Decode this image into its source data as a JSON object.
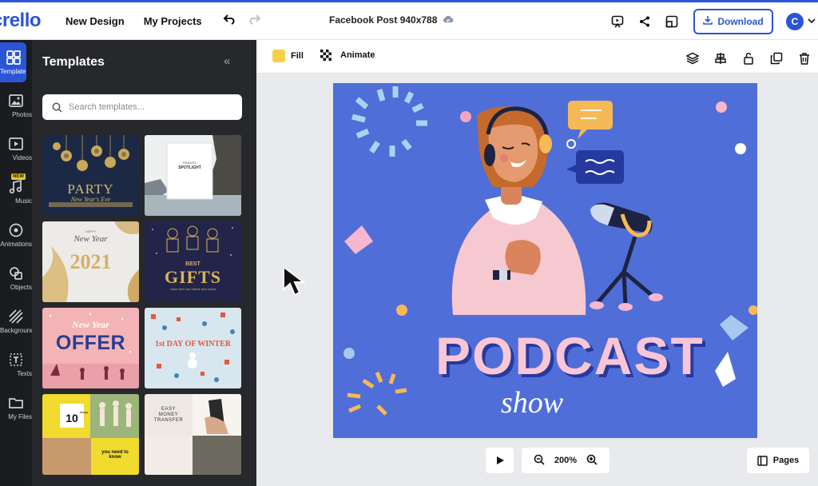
{
  "app": {
    "logo": "crello",
    "document_name": "Facebook Post 940x788"
  },
  "topnav": {
    "new_design": "New Design",
    "my_projects": "My Projects"
  },
  "header_actions": {
    "download_label": "Download",
    "avatar_letter": "C"
  },
  "sidebar": {
    "items": [
      {
        "label": "Templates",
        "icon": "templates-icon",
        "active": true
      },
      {
        "label": "Photos",
        "icon": "photo-icon"
      },
      {
        "label": "Videos",
        "icon": "video-icon"
      },
      {
        "label": "Music",
        "icon": "music-icon",
        "badge": "NEW"
      },
      {
        "label": "Animations",
        "icon": "animation-icon"
      },
      {
        "label": "Objects",
        "icon": "objects-icon"
      },
      {
        "label": "Backgrounds",
        "icon": "backgrounds-icon"
      },
      {
        "label": "Texts",
        "icon": "text-icon"
      },
      {
        "label": "My Files",
        "icon": "folder-icon"
      }
    ]
  },
  "panel": {
    "title": "Templates",
    "search_placeholder": "Search templates...",
    "templates": [
      {
        "line1": "PARTY",
        "line2": "New Year's Eve"
      },
      {
        "line1": "TRAVEL",
        "line2": "SPOTLIGHT"
      },
      {
        "line1": "HAPPY",
        "line2": "New Year",
        "line3": "2021"
      },
      {
        "line1": "BEST",
        "line2": "GIFTS",
        "line3": "come from our hearts and ovens"
      },
      {
        "line1": "New Year",
        "line2": "OFFER"
      },
      {
        "line1": "1st DAY OF WINTER"
      },
      {
        "line1": "10",
        "line2": "things",
        "line3": "you need to know"
      },
      {
        "line1": "EASY",
        "line2": "MONEY",
        "line3": "TRANSFER"
      }
    ]
  },
  "toolbar": {
    "fill_label": "Fill",
    "animate_label": "Animate",
    "fill_color": "#f7cf48"
  },
  "canvas": {
    "title": "PODCAST",
    "subtitle": "show",
    "background": "#4f6ed8"
  },
  "bottom": {
    "zoom": "200%",
    "pages_label": "Pages"
  }
}
